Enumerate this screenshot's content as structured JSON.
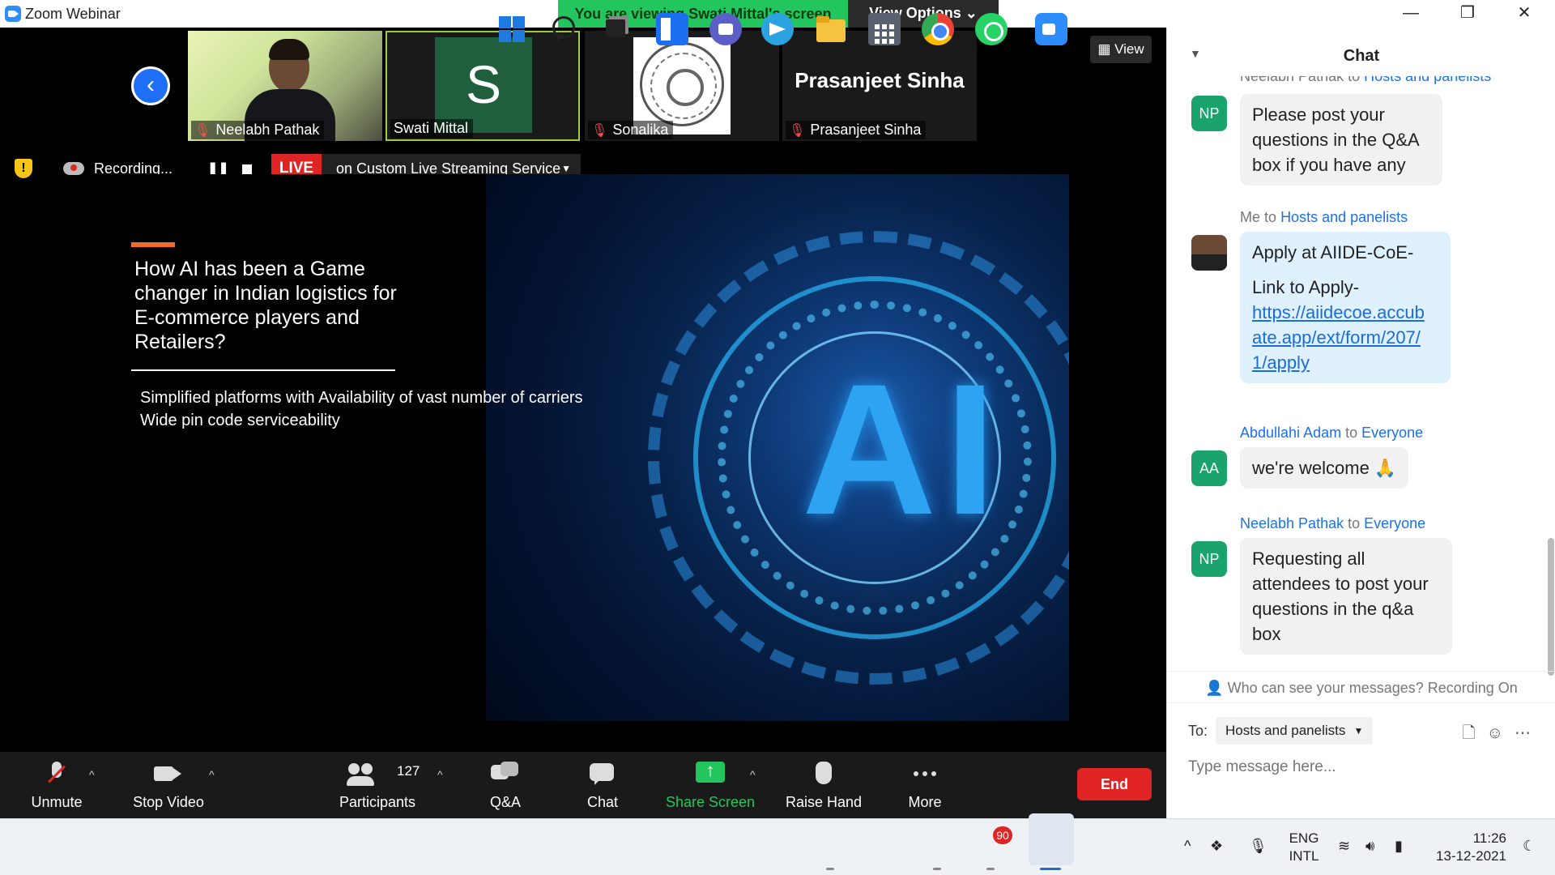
{
  "window": {
    "app_title": "Zoom Webinar",
    "viewing_banner": "You are viewing Swati Mittal's screen",
    "view_options": "View Options"
  },
  "video_strip": {
    "tiles": [
      {
        "name": "Neelabh Pathak",
        "muted": true
      },
      {
        "name": "Swati Mittal",
        "avatar_letter": "S",
        "muted": false
      },
      {
        "name": "Sonalika",
        "muted": true
      },
      {
        "name": "Prasanjeet Sinha",
        "muted": true,
        "display_name": "Prasanjeet Sinha"
      }
    ],
    "view_button": "View"
  },
  "recording": {
    "status": "Recording...",
    "live_badge": "LIVE",
    "live_service": "on Custom Live Streaming Service"
  },
  "slide": {
    "heading": "How AI has been a Game changer in Indian logistics for E-commerce players and Retailers?",
    "points": [
      "Simplified platforms with Availability of vast number of carriers",
      "Wide pin code serviceability"
    ],
    "art_text": "AI"
  },
  "toolbar": {
    "unmute": "Unmute",
    "stop_video": "Stop Video",
    "participants": "Participants",
    "participant_count": "127",
    "qa": "Q&A",
    "chat": "Chat",
    "share_screen": "Share Screen",
    "raise_hand": "Raise Hand",
    "more": "More",
    "end": "End"
  },
  "chat": {
    "title": "Chat",
    "messages": [
      {
        "sender": "Neelabh Pathak",
        "to": "Hosts and panelists",
        "to_prefix": "to",
        "avatar": "NP",
        "text": "Please post your questions in the Q&A box if you have any"
      },
      {
        "sender": "Me",
        "to": "Hosts and panelists",
        "to_prefix": "to",
        "avatar": "",
        "line1": "Apply at AIIDE-CoE-",
        "line2": "Link to Apply-",
        "link": "https://aiidecoe.accubate.app/ext/form/207/1/apply",
        "link_lines": [
          "https://aiidecoe.accub",
          "ate.app/ext/form/207/",
          "1/apply"
        ]
      },
      {
        "sender": "Abdullahi Adam",
        "to": "Everyone",
        "to_prefix": "to",
        "avatar": "AA",
        "text": "we're welcome 🙏"
      },
      {
        "sender": "Neelabh Pathak",
        "to": "Everyone",
        "to_prefix": "to",
        "avatar": "NP",
        "text": "Requesting all attendees to post your questions in the q&a box"
      }
    ],
    "visibility_notice": "Who can see your messages? Recording On",
    "to_label": "To:",
    "to_value": "Hosts and panelists",
    "input_placeholder": "Type message here..."
  },
  "taskbar": {
    "whatsapp_badge": "90",
    "lang_line1": "ENG",
    "lang_line2": "INTL",
    "time": "11:26",
    "date": "13-12-2021"
  }
}
